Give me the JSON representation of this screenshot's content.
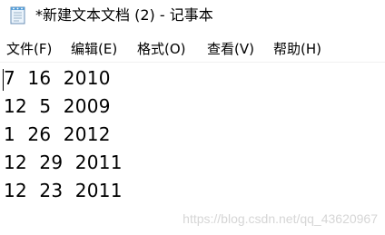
{
  "window": {
    "title": "*新建文本文档 (2) - 记事本",
    "icon": "notepad-icon"
  },
  "menu": {
    "items": [
      {
        "label": "文件(F)"
      },
      {
        "label": "编辑(E)"
      },
      {
        "label": "格式(O)"
      },
      {
        "label": "查看(V)"
      },
      {
        "label": "帮助(H)"
      }
    ]
  },
  "editor": {
    "lines": [
      "7  16  2010",
      "12  5  2009",
      "1  26  2012",
      "12  29  2011",
      "12  23  2011"
    ]
  },
  "watermark": {
    "text": "https://blog.csdn.net/qq_43620967"
  }
}
